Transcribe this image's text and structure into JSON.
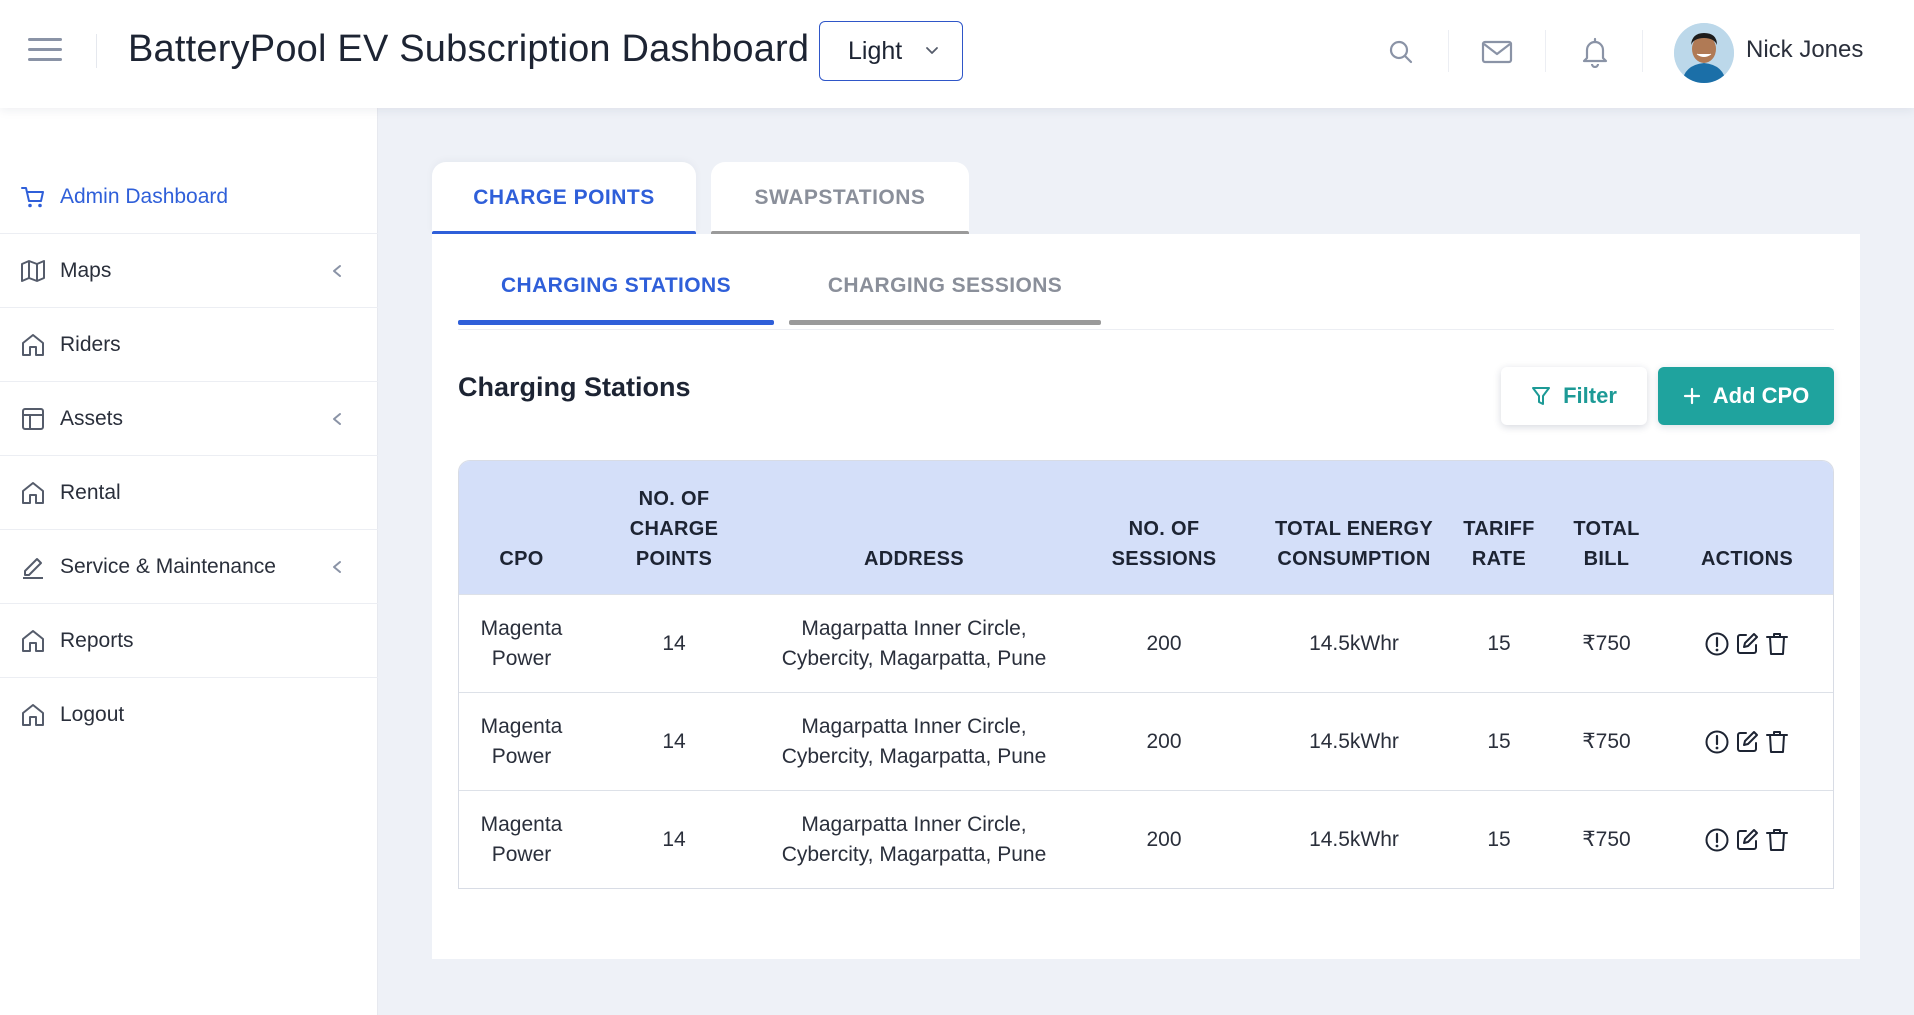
{
  "header": {
    "title": "BatteryPool EV Subscription Dashboard",
    "theme_value": "Light",
    "user_name": "Nick Jones"
  },
  "sidebar": {
    "items": [
      {
        "label": "Admin Dashboard",
        "icon": "cart-icon",
        "active": true,
        "expandable": false
      },
      {
        "label": "Maps",
        "icon": "map-icon",
        "active": false,
        "expandable": true
      },
      {
        "label": "Riders",
        "icon": "home-icon",
        "active": false,
        "expandable": false
      },
      {
        "label": "Assets",
        "icon": "layout-icon",
        "active": false,
        "expandable": true
      },
      {
        "label": "Rental",
        "icon": "home-icon",
        "active": false,
        "expandable": false
      },
      {
        "label": "Service & Maintenance",
        "icon": "pencil-icon",
        "active": false,
        "expandable": true
      },
      {
        "label": "Reports",
        "icon": "home-icon",
        "active": false,
        "expandable": false
      },
      {
        "label": "Logout",
        "icon": "home-icon",
        "active": false,
        "expandable": false
      }
    ]
  },
  "tabs": {
    "charge_points": "CHARGE POINTS",
    "swapstations": "SWAPSTATIONS"
  },
  "subtabs": {
    "charging_stations": "CHARGING STATIONS",
    "charging_sessions": "CHARGING SESSIONS"
  },
  "section": {
    "title": "Charging Stations",
    "filter_label": "Filter",
    "add_label": "Add CPO"
  },
  "table": {
    "headers": [
      "CPO",
      "NO. OF\nCHARGE\nPOINTS",
      "ADDRESS",
      "NO. OF\nSESSIONS",
      "TOTAL ENERGY\nCONSUMPTION",
      "TARIFF\nRATE",
      "TOTAL\nBILL",
      "ACTIONS"
    ],
    "rows": [
      {
        "cpo": "Magenta Power",
        "charge_points": "14",
        "address": "Magarpatta Inner Circle, Cybercity, Magarpatta, Pune",
        "sessions": "200",
        "energy": "14.5kWhr",
        "tariff": "15",
        "bill": "₹750"
      },
      {
        "cpo": "Magenta Power",
        "charge_points": "14",
        "address": "Magarpatta Inner Circle, Cybercity, Magarpatta, Pune",
        "sessions": "200",
        "energy": "14.5kWhr",
        "tariff": "15",
        "bill": "₹750"
      },
      {
        "cpo": "Magenta Power",
        "charge_points": "14",
        "address": "Magarpatta Inner Circle, Cybercity, Magarpatta, Pune",
        "sessions": "200",
        "energy": "14.5kWhr",
        "tariff": "15",
        "bill": "₹750"
      }
    ]
  },
  "colors": {
    "primary": "#2f5fd9",
    "teal": "#1fa39e",
    "table_header_bg": "#d4dff9",
    "page_bg": "#eef1f7"
  }
}
